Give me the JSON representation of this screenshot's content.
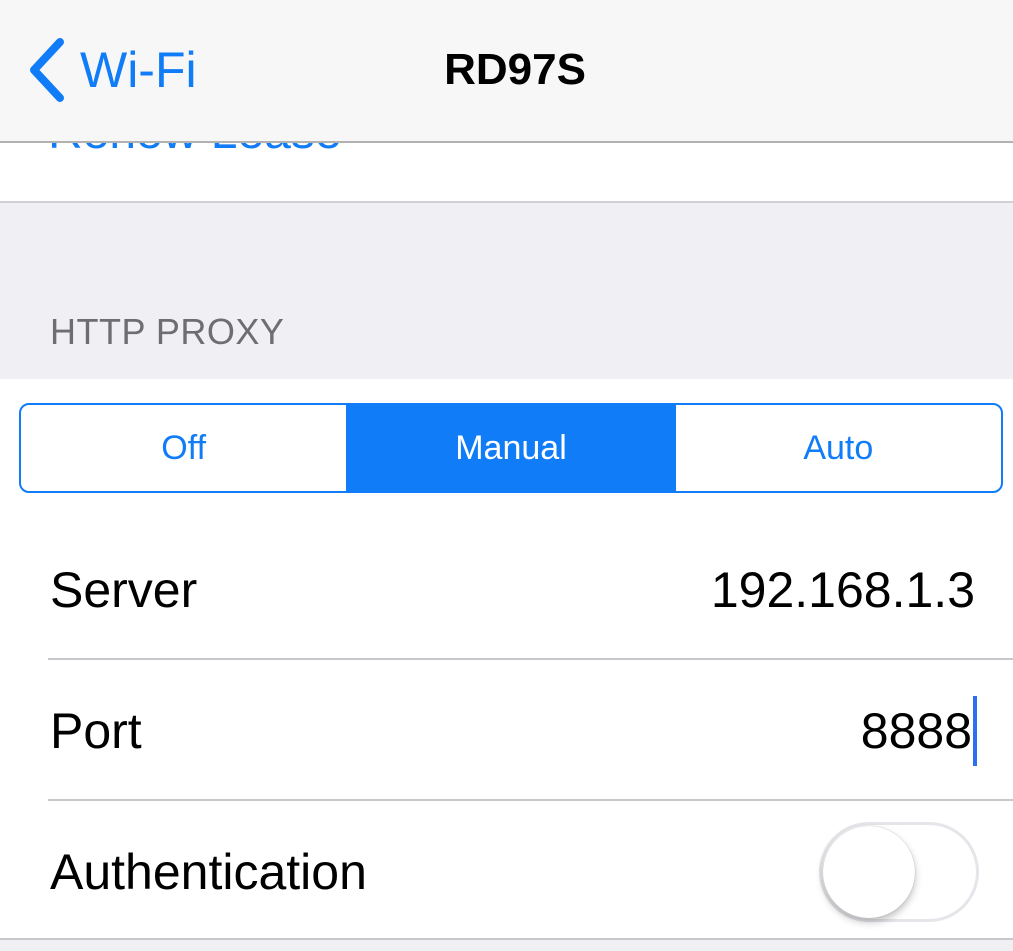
{
  "navbar": {
    "back_label": "Wi-Fi",
    "title": "RD97S"
  },
  "renew_lease": {
    "label": "Renew Lease"
  },
  "http_proxy": {
    "section_header": "HTTP PROXY",
    "modes": [
      "Off",
      "Manual",
      "Auto"
    ],
    "selected_mode": "Manual",
    "server": {
      "label": "Server",
      "value": "192.168.1.3"
    },
    "port": {
      "label": "Port",
      "value": "8888"
    },
    "authentication": {
      "label": "Authentication",
      "enabled": false
    }
  },
  "colors": {
    "accent": "#117cf7",
    "group_background": "#efeff4",
    "navbar_background": "#f7f7f7",
    "separator": "#c8c7cc",
    "section_header_text": "#6d6d72",
    "text_cursor": "#2f6df2"
  },
  "icons": {
    "back": "chevron-left-icon"
  }
}
